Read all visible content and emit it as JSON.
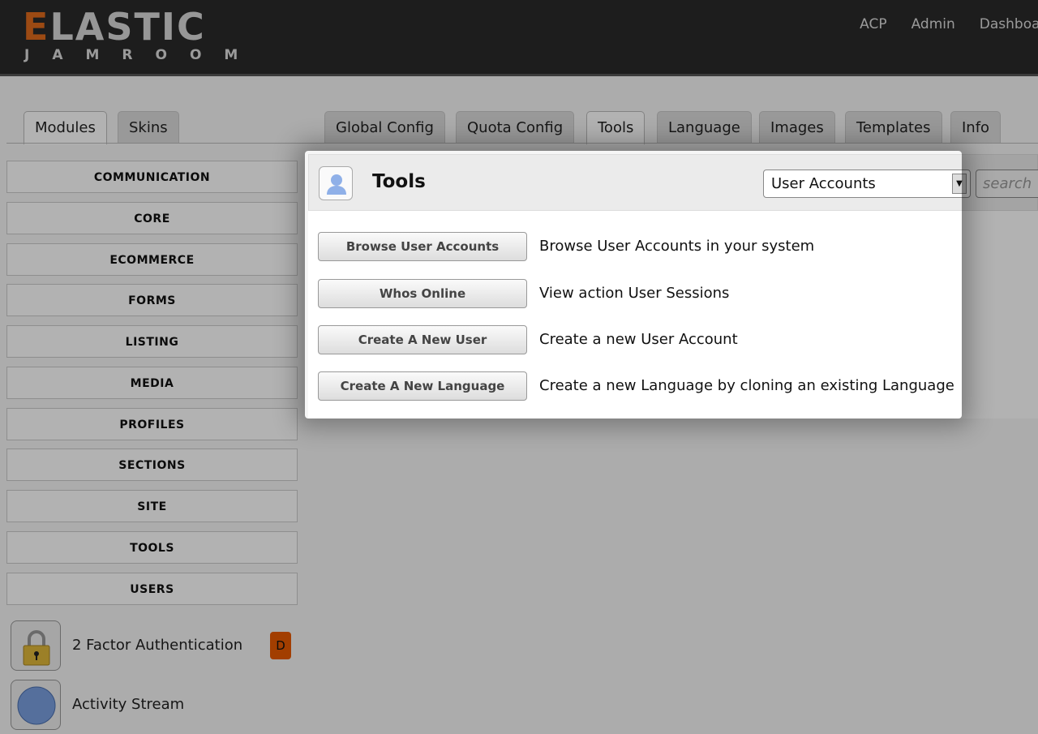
{
  "header": {
    "logo_top": "ELASTIC",
    "logo_bottom": "JAMROOM",
    "nav": [
      "ACP",
      "Admin",
      "Dashboard"
    ]
  },
  "left_tabs": [
    "Modules",
    "Skins"
  ],
  "main_tabs": [
    "Global Config",
    "Quota Config",
    "Tools",
    "Language",
    "Images",
    "Templates",
    "Info"
  ],
  "categories": [
    "COMMUNICATION",
    "CORE",
    "ECOMMERCE",
    "FORMS",
    "LISTING",
    "MEDIA",
    "PROFILES",
    "SECTIONS",
    "SITE",
    "TOOLS",
    "USERS"
  ],
  "modules": [
    {
      "name": "2 Factor Authentication",
      "badge": "D"
    },
    {
      "name": "Activity Stream"
    }
  ],
  "panel": {
    "title": "Tools",
    "select_value": "User Accounts",
    "search_placeholder": "search",
    "tools": [
      {
        "button": "Browse User Accounts",
        "desc": "Browse User Accounts in your system"
      },
      {
        "button": "Whos Online",
        "desc": "View action User Sessions"
      },
      {
        "button": "Create A New User",
        "desc": "Create a new User Account"
      },
      {
        "button": "Create A New Language",
        "desc": "Create a new Language by cloning an existing Language"
      }
    ]
  }
}
